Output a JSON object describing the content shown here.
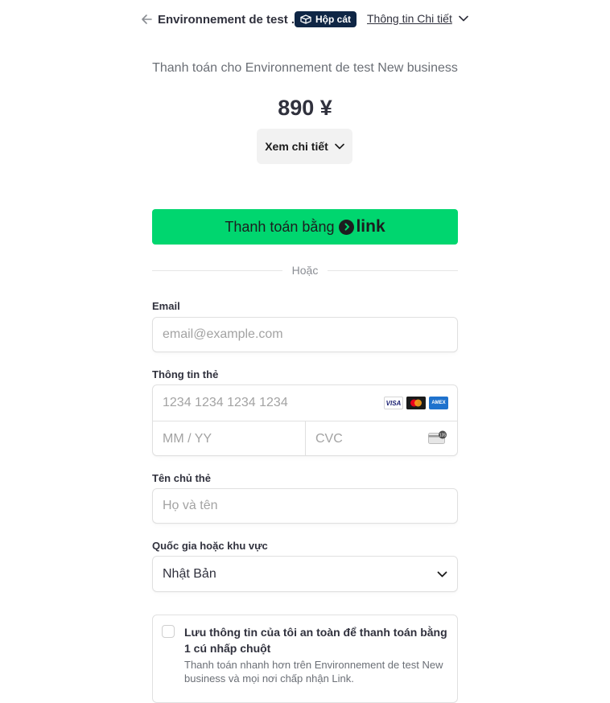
{
  "header": {
    "merchant_name": "Environnement de test ...",
    "sandbox_badge": "Hộp cát",
    "details_link": "Thông tin Chi tiết"
  },
  "summary": {
    "pay_for": "Thanh toán cho Environnement de test New business",
    "amount": "890 ¥",
    "view_details": "Xem chi tiết"
  },
  "link_button": {
    "label": "Thanh toán bằng",
    "brand": "link",
    "color": "#00d66f"
  },
  "divider": {
    "text": "Hoặc"
  },
  "form": {
    "email": {
      "label": "Email",
      "placeholder": "email@example.com",
      "value": ""
    },
    "card": {
      "label": "Thông tin thẻ",
      "number_placeholder": "1234 1234 1234 1234",
      "expiry_placeholder": "MM / YY",
      "cvc_placeholder": "CVC",
      "brands": [
        "VISA",
        "Mastercard",
        "AMEX"
      ]
    },
    "cardholder": {
      "label": "Tên chủ thẻ",
      "placeholder": "Họ và tên",
      "value": ""
    },
    "country": {
      "label": "Quốc gia hoặc khu vực",
      "selected": "Nhật Bản"
    },
    "save_info": {
      "checked": false,
      "title": "Lưu thông tin của tôi an toàn để thanh toán bằng 1 cú nhấp chuột",
      "description": "Thanh toán nhanh hơn trên Environnement de test New business và mọi nơi chấp nhận Link."
    }
  }
}
